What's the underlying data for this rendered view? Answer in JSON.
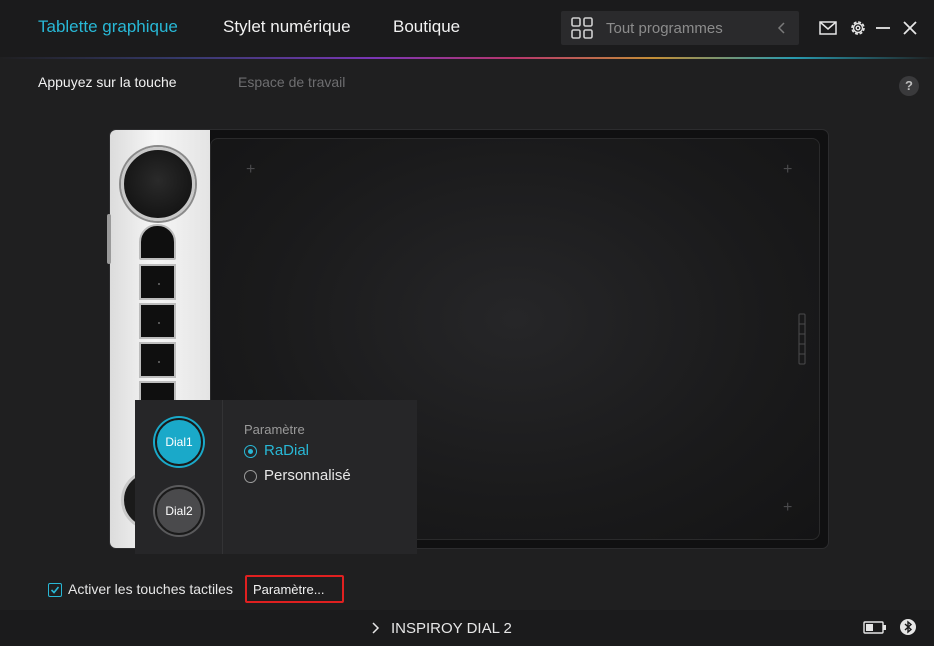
{
  "nav": {
    "tabs": [
      {
        "label": "Tablette graphique",
        "active": true
      },
      {
        "label": "Stylet numérique",
        "active": false
      },
      {
        "label": "Boutique",
        "active": false
      }
    ],
    "search": {
      "placeholder": "Tout programmes"
    }
  },
  "subtabs": [
    {
      "label": "Appuyez sur la touche",
      "active": true
    },
    {
      "label": "Espace de travail",
      "active": false
    }
  ],
  "help_label": "?",
  "popup": {
    "dials": [
      {
        "label": "Dial1",
        "active": true
      },
      {
        "label": "Dial2",
        "active": false
      }
    ],
    "section_title": "Paramètre",
    "options": [
      {
        "label": "RaDial",
        "selected": true
      },
      {
        "label": "Personnalisé",
        "selected": false
      }
    ]
  },
  "bottom": {
    "touch_checkbox": {
      "label": "Activer les touches tactiles",
      "checked": true
    },
    "settings_button": "Paramètre..."
  },
  "status": {
    "device_name": "INSPIROY DIAL 2"
  },
  "colors": {
    "accent": "#28b8d6",
    "highlight_border": "#e02020",
    "background": "#1f1f20"
  }
}
